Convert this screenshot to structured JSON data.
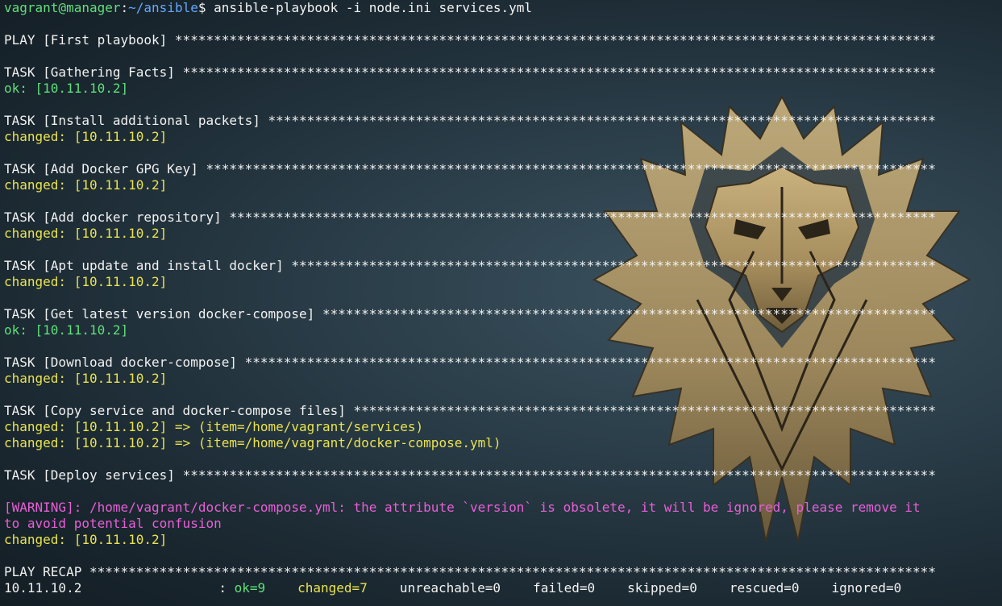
{
  "prompt": {
    "user_host": "vagrant@manager",
    "colon": ":",
    "path": "~/ansible",
    "dollar": "$ ",
    "command": "ansible-playbook -i node.ini services.yml"
  },
  "play": {
    "header": "PLAY [First playbook] "
  },
  "tasks": [
    {
      "header": "TASK [Gathering Facts] ",
      "results": [
        {
          "text": "ok: [10.11.10.2]",
          "status": "ok"
        }
      ]
    },
    {
      "header": "TASK [Install additional packets] ",
      "results": [
        {
          "text": "changed: [10.11.10.2]",
          "status": "changed"
        }
      ]
    },
    {
      "header": "TASK [Add Docker GPG Key] ",
      "results": [
        {
          "text": "changed: [10.11.10.2]",
          "status": "changed"
        }
      ]
    },
    {
      "header": "TASK [Add docker repository] ",
      "results": [
        {
          "text": "changed: [10.11.10.2]",
          "status": "changed"
        }
      ]
    },
    {
      "header": "TASK [Apt update and install docker] ",
      "results": [
        {
          "text": "changed: [10.11.10.2]",
          "status": "changed"
        }
      ]
    },
    {
      "header": "TASK [Get latest version docker-compose] ",
      "results": [
        {
          "text": "ok: [10.11.10.2]",
          "status": "ok"
        }
      ]
    },
    {
      "header": "TASK [Download docker-compose] ",
      "results": [
        {
          "text": "changed: [10.11.10.2]",
          "status": "changed"
        }
      ]
    },
    {
      "header": "TASK [Copy service and docker-compose files] ",
      "results": [
        {
          "text": "changed: [10.11.10.2] => (item=/home/vagrant/services)",
          "status": "changed"
        },
        {
          "text": "changed: [10.11.10.2] => (item=/home/vagrant/docker-compose.yml)",
          "status": "changed"
        }
      ]
    },
    {
      "header": "TASK [Deploy services] ",
      "results": []
    }
  ],
  "warning": {
    "line1": "[WARNING]: /home/vagrant/docker-compose.yml: the attribute `version` is obsolete, it will be ignored, please remove it",
    "line2": "to avoid potential confusion"
  },
  "deploy_result": "changed: [10.11.10.2]",
  "recap": {
    "header": "PLAY RECAP ",
    "host": "10.11.10.2",
    "separator": ": ",
    "ok": "ok=9",
    "changed": "changed=7",
    "unreachable": "unreachable=0",
    "failed": "failed=0",
    "skipped": "skipped=0",
    "rescued": "rescued=0",
    "ignored": "ignored=0"
  },
  "colors": {
    "ok": "#5fe07a",
    "changed": "#e9e34f",
    "warning": "#e85fd6",
    "text": "#f2f2f2",
    "path": "#64a9ff",
    "emblem_gold": "#b39a6a"
  },
  "wallpaper_icon": "lion-emblem-icon"
}
